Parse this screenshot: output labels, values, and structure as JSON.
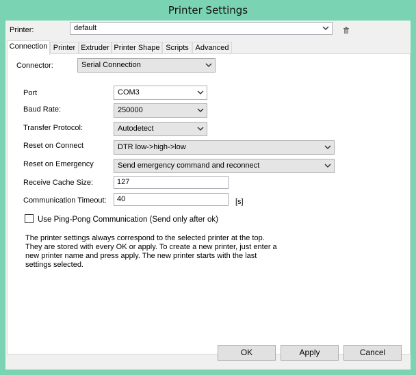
{
  "window": {
    "title": "Printer Settings"
  },
  "printer": {
    "label": "Printer:",
    "value": "default"
  },
  "tabs": [
    "Connection",
    "Printer",
    "Extruder",
    "Printer Shape",
    "Scripts",
    "Advanced"
  ],
  "connection": {
    "connector_label": "Connector:",
    "connector_value": "Serial Connection",
    "port_label": "Port",
    "port_value": "COM3",
    "baud_label": "Baud Rate:",
    "baud_value": "250000",
    "protocol_label": "Transfer Protocol:",
    "protocol_value": "Autodetect",
    "reset_connect_label": "Reset on Connect",
    "reset_connect_value": "DTR low->high->low",
    "reset_emergency_label": "Reset on Emergency",
    "reset_emergency_value": "Send emergency command and reconnect",
    "cache_label": "Receive Cache Size:",
    "cache_value": "127",
    "timeout_label": "Communication Timeout:",
    "timeout_value": "40",
    "timeout_unit": "[s]",
    "pingpong_label": "Use Ping-Pong Communication (Send only after ok)",
    "pingpong_checked": false,
    "help_text": "The printer settings always correspond to the selected printer at the top. They are stored with every OK or apply. To create a new printer, just enter a new printer name and press apply. The new printer starts with the last settings selected."
  },
  "buttons": {
    "ok": "OK",
    "apply": "Apply",
    "cancel": "Cancel"
  },
  "icons": {
    "delete": "trash-icon",
    "dropdown": "chevron-down-icon"
  },
  "colors": {
    "frame": "#7ad3b2",
    "dialog": "#f0f0f0"
  }
}
